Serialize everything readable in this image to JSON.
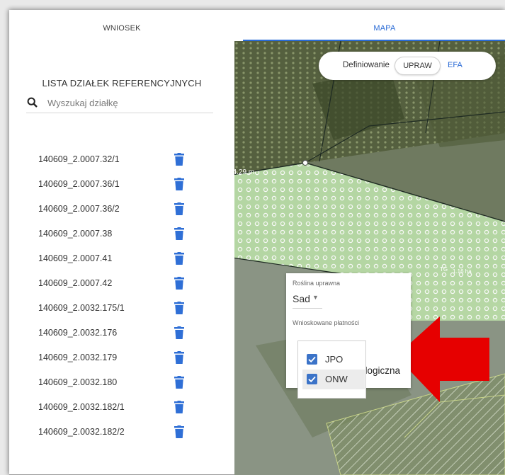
{
  "tabs": {
    "wniosek": "WNIOSEK",
    "mapa": "MAPA"
  },
  "panel": {
    "title": "LISTA DZIAŁEK REFERENCYJNYCH",
    "search_placeholder": "Wyszukaj działkę",
    "plots": [
      "140609_2.0007.32/1",
      "140609_2.0007.36/1",
      "140609_2.0007.36/2",
      "140609_2.0007.38",
      "140609_2.0007.41",
      "140609_2.0007.42",
      "140609_2.0032.175/1",
      "140609_2.0032.176",
      "140609_2.0032.179",
      "140609_2.0032.180",
      "140609_2.0032.182/1",
      "140609_2.0032.182/2"
    ],
    "delete_icon": "trash-icon"
  },
  "map": {
    "toggle_label": "Definiowanie",
    "toggle_upraw": "UPRAW",
    "toggle_efa": "EFA",
    "measure_label": "54.29 m",
    "parcel_label_a": "TG",
    "parcel_label_b": "1.16 ha"
  },
  "popup": {
    "crop_label": "Roślina uprawna",
    "crop_value": "Sad",
    "payments_label": "Wnioskowane płatności",
    "options": [
      {
        "label": "JPO",
        "checked": true
      },
      {
        "label": "ONW",
        "checked": true
      }
    ],
    "partial_text": "ologiczna"
  },
  "colors": {
    "accent": "#2a6bd6",
    "checkbox": "#3b73c8",
    "arrow": "#e60000",
    "parcel_fill": "#b7e0a8"
  }
}
